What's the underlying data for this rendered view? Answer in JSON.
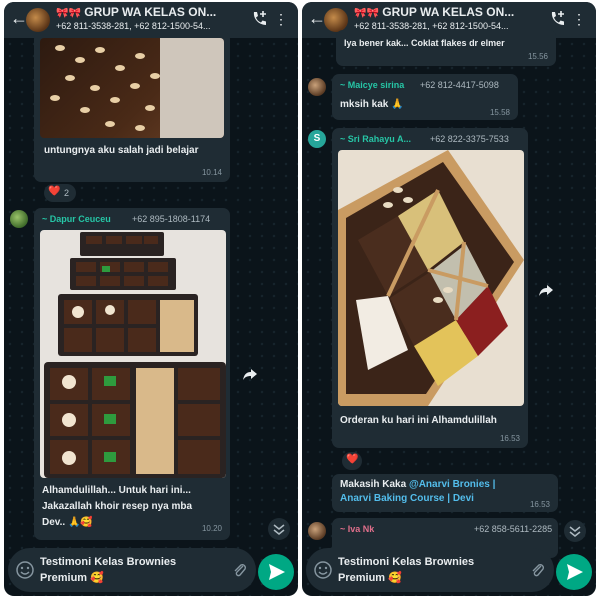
{
  "header": {
    "title": "GRUP WA KELAS ON...",
    "emoji": "🎀🎀",
    "subtitle": "+62 811-3538-281, +62 812-1500-54..."
  },
  "right_header": {
    "subtitle": "+62 811-3538-281, +62 812-1500-54..."
  },
  "left": {
    "msg1": {
      "text": "untungnya aku salah jadi belajar",
      "time": "10.14"
    },
    "reaction": {
      "emoji": "❤️",
      "count": "2"
    },
    "msg2": {
      "sender": "~ Dapur Ceuceu",
      "phone": "+62 895-1808-1174",
      "text_line1": "Alhamdulillah... Untuk hari ini...",
      "text_line2": "Jakazallah khoir resep nya mba",
      "text_line3": "Dev.. 🙏🥰",
      "time": "10.20"
    }
  },
  "right": {
    "msg0": {
      "text": "Iya bener kak... Coklat flakes dr elmer",
      "time": "15.56"
    },
    "msg1": {
      "sender": "~ Maicye sirina",
      "phone": "+62 812-4417-5098",
      "text": "mksih kak 🙏",
      "time": "15.58"
    },
    "msg2": {
      "sender": "~ Sri Rahayu A...",
      "phone": "+62 822-3375-7533",
      "avatar_letter": "S",
      "text": "Orderan ku hari ini Alhamdulillah",
      "time": "16.53"
    },
    "reaction": {
      "emoji": "❤️"
    },
    "msg3": {
      "text_plain": "Makasih Kaka ",
      "mention": "@Anarvi Bronies |",
      "text_line2": "Anarvi Baking Course | Devi",
      "time": "16.53"
    },
    "msg4": {
      "sender": "~ Iva Nk",
      "phone": "+62 858-5611-2285"
    }
  },
  "input": {
    "line1": "Testimoni Kelas Brownies",
    "line2": "Premium 🥰"
  },
  "icons": [
    "back-arrow-icon",
    "phone-plus-icon",
    "menu-dots-icon",
    "emoji-icon",
    "attach-icon",
    "send-icon",
    "forward-icon",
    "chevron-down-icon"
  ],
  "colors": {
    "background": "#0b141a",
    "bubble": "#1f2c34",
    "accent": "#00a884",
    "sender": "#26c6a6",
    "mention": "#53bdeb"
  }
}
